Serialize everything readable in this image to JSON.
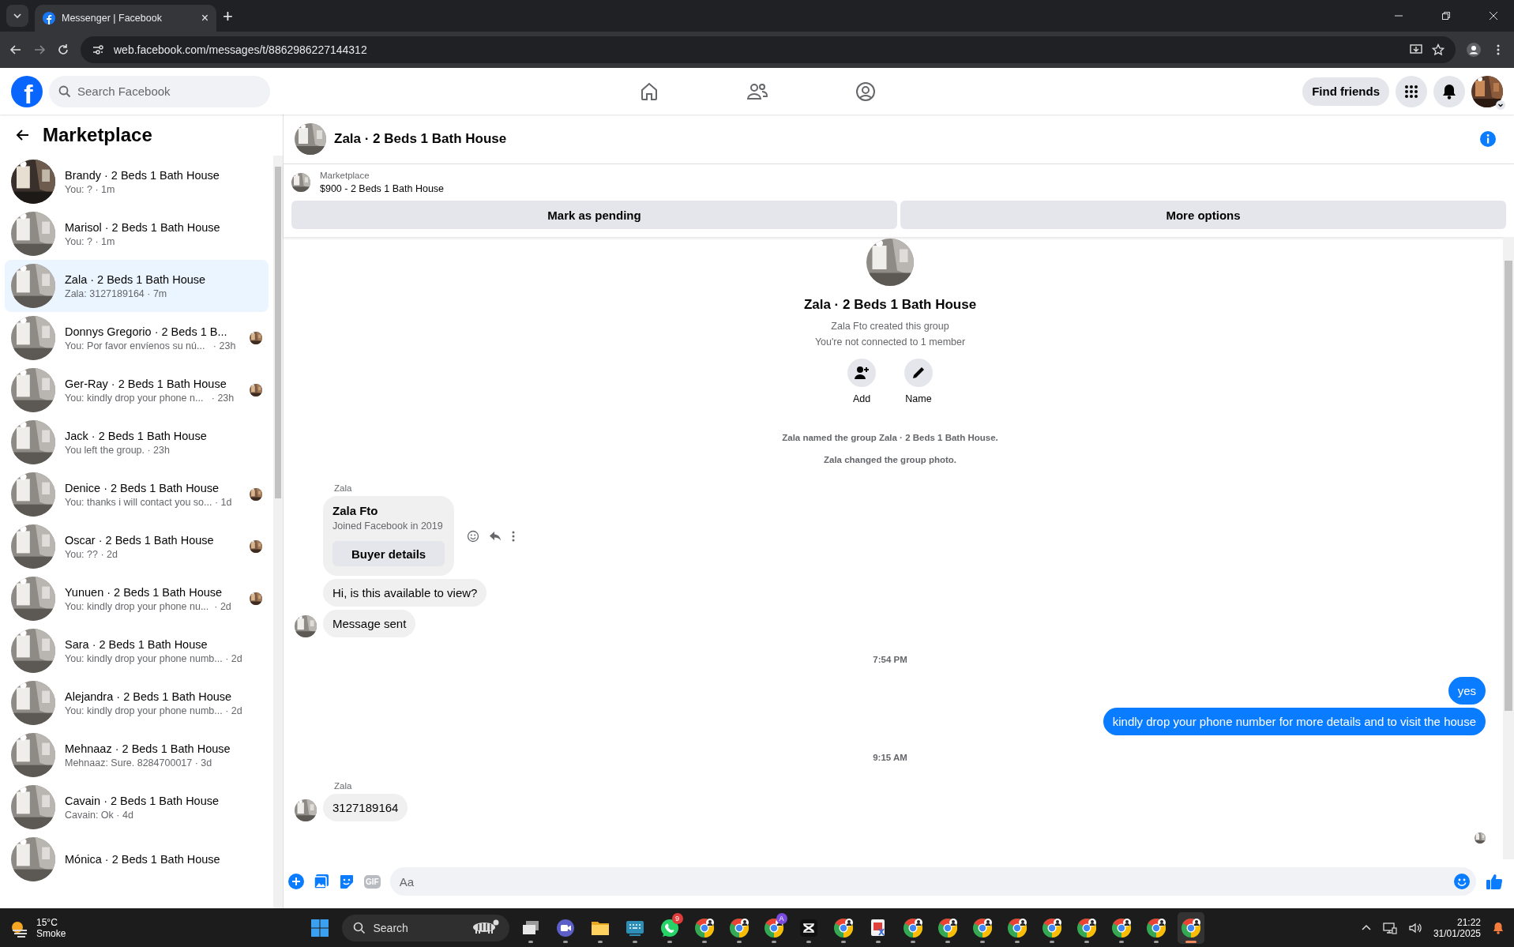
{
  "browser": {
    "tab": {
      "title": "Messenger | Facebook",
      "close": "×"
    },
    "new_tab": "+",
    "url": "web.facebook.com/messages/t/8862986227144312"
  },
  "header": {
    "logo": "f",
    "search": {
      "placeholder": "Search Facebook"
    },
    "find_friends": "Find friends"
  },
  "sidebar": {
    "title": "Marketplace",
    "conversations": [
      {
        "name": "Brandy · 2 Beds 1 Bath House",
        "preview": "You: ? · 1m",
        "selected": false,
        "seen": false
      },
      {
        "name": "Marisol · 2 Beds 1 Bath House",
        "preview": "You: ? · 1m",
        "selected": false,
        "seen": false
      },
      {
        "name": "Zala · 2 Beds 1 Bath House",
        "preview": "Zala: 3127189164 · 7m",
        "selected": true,
        "seen": false
      },
      {
        "name": "Donnys Gregorio · 2 Beds 1 B...",
        "preview": "You: Por favor envíenos su nú...   · 23h",
        "selected": false,
        "seen": true
      },
      {
        "name": "Ger-Ray · 2 Beds 1 Bath House",
        "preview": "You: kindly drop your phone n...   · 23h",
        "selected": false,
        "seen": true
      },
      {
        "name": "Jack · 2 Beds 1 Bath House",
        "preview": "You left the group. · 23h",
        "selected": false,
        "seen": false
      },
      {
        "name": "Denice · 2 Beds 1 Bath House",
        "preview": "You: thanks i will contact you so... · 1d",
        "selected": false,
        "seen": true
      },
      {
        "name": "Oscar · 2 Beds 1 Bath House",
        "preview": "You: ?? · 2d",
        "selected": false,
        "seen": true
      },
      {
        "name": "Yunuen · 2 Beds 1 Bath House",
        "preview": "You: kindly drop your phone nu...  · 2d",
        "selected": false,
        "seen": true
      },
      {
        "name": "Sara · 2 Beds 1 Bath House",
        "preview": "You: kindly drop your phone numb... · 2d",
        "selected": false,
        "seen": false
      },
      {
        "name": "Alejandra · 2 Beds 1 Bath House",
        "preview": "You: kindly drop your phone numb... · 2d",
        "selected": false,
        "seen": false
      },
      {
        "name": "Mehnaaz · 2 Beds 1 Bath House",
        "preview": "Mehnaaz: Sure. 8284700017 · 3d",
        "selected": false,
        "seen": false
      },
      {
        "name": "Cavain · 2 Beds 1 Bath House",
        "preview": "Cavain: Ok · 4d",
        "selected": false,
        "seen": false
      },
      {
        "name": "Mónica · 2 Beds 1 Bath House",
        "selected": false,
        "seen": false
      }
    ]
  },
  "chat": {
    "title": "Zala · 2 Beds 1 Bath House",
    "listing": {
      "source": "Marketplace",
      "title": "$900 - 2 Beds 1 Bath House"
    },
    "actions": [
      "Mark as pending",
      "More options"
    ],
    "intro": {
      "title": "Zala · 2 Beds 1 Bath House",
      "lines": [
        "Zala Fto created this group",
        "You're not connected to 1 member"
      ],
      "buttons": [
        {
          "label": "Add",
          "kind": "add"
        },
        {
          "label": "Name",
          "kind": "name"
        }
      ]
    },
    "events": [
      {
        "kind": "notice",
        "text": "Zala named the group Zala · 2 Beds 1 Bath House."
      },
      {
        "kind": "notice",
        "text": "Zala changed the group photo."
      },
      {
        "kind": "sender",
        "text": "Zala"
      },
      {
        "kind": "card",
        "title": "Zala Fto",
        "subtitle": "Joined Facebook in 2019",
        "button": "Buyer details"
      },
      {
        "kind": "incoming",
        "text": "Hi, is this available to view?",
        "avatar": false
      },
      {
        "kind": "incoming",
        "text": "Message sent",
        "avatar": true
      },
      {
        "kind": "time",
        "text": "7:54 PM"
      },
      {
        "kind": "outgoing",
        "text": "yes"
      },
      {
        "kind": "outgoing",
        "text": "kindly drop your phone number for more details and to visit the house"
      },
      {
        "kind": "time",
        "text": "9:15 AM"
      },
      {
        "kind": "sender",
        "text": "Zala"
      },
      {
        "kind": "incoming",
        "text": "3127189164",
        "avatar": true
      }
    ],
    "composer": {
      "placeholder": "Aa",
      "gif": "GIF"
    }
  },
  "taskbar": {
    "weather": {
      "temp": "15°C",
      "label": "Smoke"
    },
    "search": "Search",
    "apps": [
      {
        "kind": "taskview",
        "selected": false
      },
      {
        "kind": "meet",
        "selected": false
      },
      {
        "kind": "folder",
        "selected": false
      },
      {
        "kind": "keyboard",
        "selected": false
      },
      {
        "kind": "whatsapp",
        "selected": false,
        "badge": "9"
      },
      {
        "kind": "chrome",
        "selected": false
      },
      {
        "kind": "chrome",
        "selected": false
      },
      {
        "kind": "chrome",
        "selected": false,
        "badge": "A"
      },
      {
        "kind": "capcut",
        "selected": false
      },
      {
        "kind": "chrome",
        "selected": false
      },
      {
        "kind": "snip",
        "selected": false
      },
      {
        "kind": "chrome",
        "selected": false
      },
      {
        "kind": "chrome",
        "selected": false
      },
      {
        "kind": "chrome",
        "selected": false
      },
      {
        "kind": "chrome",
        "selected": false
      },
      {
        "kind": "chrome",
        "selected": false
      },
      {
        "kind": "chrome",
        "selected": false
      },
      {
        "kind": "chrome",
        "selected": false
      },
      {
        "kind": "chrome",
        "selected": false
      },
      {
        "kind": "chrome",
        "selected": true
      }
    ],
    "time": "21:22",
    "date": "31/01/2025"
  }
}
